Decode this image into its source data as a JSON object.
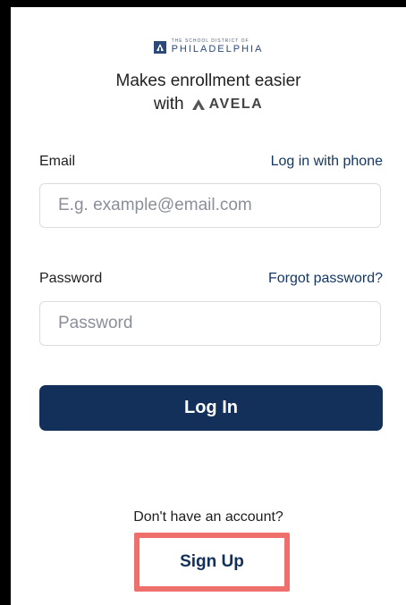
{
  "header": {
    "district_small": "THE SCHOOL DISTRICT OF",
    "district_name": "PHILADELPHIA",
    "tagline_line1": "Makes enrollment easier",
    "tagline_with": "with",
    "brand_name": "AVELA"
  },
  "email": {
    "label": "Email",
    "alt_link": "Log in with phone",
    "placeholder": "E.g. example@email.com",
    "value": ""
  },
  "password": {
    "label": "Password",
    "forgot_link": "Forgot password?",
    "placeholder": "Password",
    "value": ""
  },
  "actions": {
    "login_label": "Log In",
    "no_account_text": "Don't have an account?",
    "signup_label": "Sign Up"
  },
  "colors": {
    "primary": "#12305a",
    "highlight": "#ef6f6c",
    "link": "#143863"
  }
}
